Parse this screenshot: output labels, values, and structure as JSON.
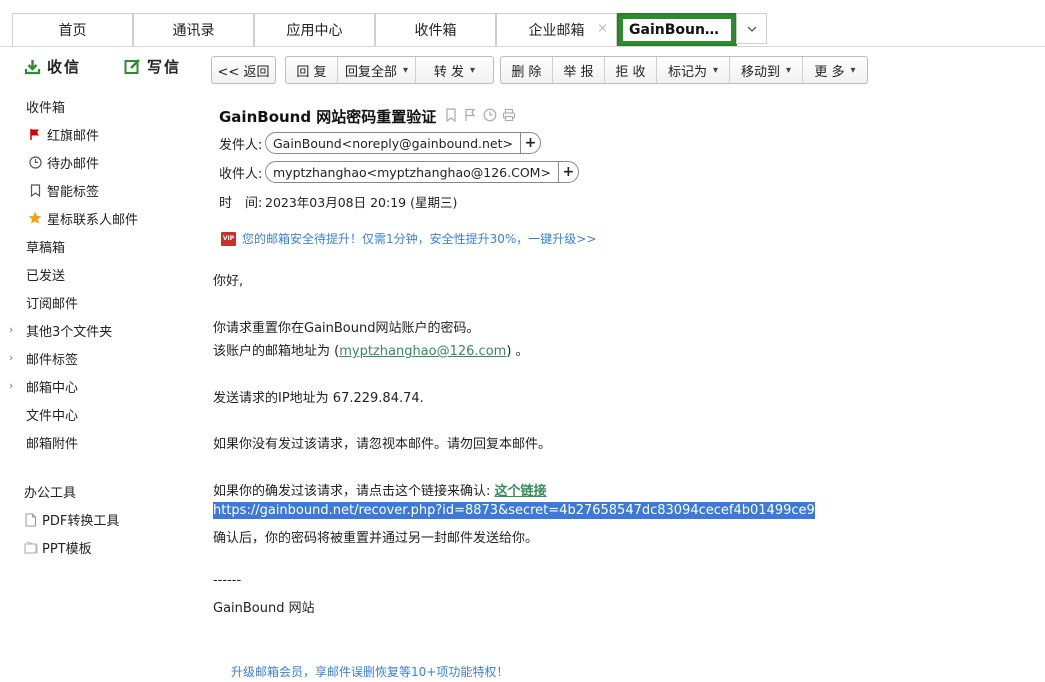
{
  "tabs": [
    {
      "label": "首页"
    },
    {
      "label": "通讯录"
    },
    {
      "label": "应用中心"
    },
    {
      "label": "收件箱"
    },
    {
      "label": "企业邮箱",
      "close": "×"
    },
    {
      "label": "GainBoun…",
      "active": true
    }
  ],
  "sidebar": {
    "receive": "收信",
    "compose": "写信",
    "items": [
      {
        "label": "收件箱"
      },
      {
        "label": "红旗邮件"
      },
      {
        "label": "待办邮件"
      },
      {
        "label": "智能标签"
      },
      {
        "label": "星标联系人邮件"
      },
      {
        "label": "草稿箱"
      },
      {
        "label": "已发送"
      },
      {
        "label": "订阅邮件"
      },
      {
        "label": "其他3个文件夹"
      },
      {
        "label": "邮件标签"
      },
      {
        "label": "邮箱中心"
      },
      {
        "label": "文件中心"
      },
      {
        "label": "邮箱附件"
      }
    ],
    "tools_title": "办公工具",
    "tools": [
      {
        "label": "PDF转换工具"
      },
      {
        "label": "PPT模板"
      }
    ]
  },
  "toolbar": {
    "back": "<< 返回",
    "reply": "回 复",
    "reply_all": "回复全部",
    "forward": "转 发",
    "delete": "删 除",
    "report": "举 报",
    "reject": "拒 收",
    "mark_as": "标记为",
    "move_to": "移动到",
    "more": "更 多"
  },
  "mail": {
    "subject": "GainBound 网站密码重置验证",
    "from_label": "发件人:",
    "from": "GainBound<noreply@gainbound.net>",
    "to_label": "收件人:",
    "to": "myptzhanghao<myptzhanghao@126.COM>",
    "time_label": "时　间:",
    "time": "2023年03月08日 20:19 (星期三)",
    "vip_badge": "VIP",
    "promo": "您的邮箱安全待提升！仅需1分钟，安全性提升30%，一键升级>>",
    "greeting": "你好,",
    "p1": "你请求重置你在GainBound网站账户的密码。",
    "p2_prefix": "该账户的邮箱地址为 (",
    "p2_email": "myptzhanghao@126.com",
    "p2_suffix": ") 。",
    "p3": "发送请求的IP地址为 67.229.84.74.",
    "p4": "如果你没有发过该请求，请忽视本邮件。请勿回复本邮件。",
    "p5_prefix": "如果你的确发过该请求，请点击这个链接来确认: ",
    "p5_link": "这个链接",
    "url": "https://gainbound.net/recover.php?id=8873&secret=4b27658547dc83094cecef4b01499ce9",
    "p6": "确认后，你的密码将被重置并通过另一封邮件发送给你。",
    "sig_sep": "------",
    "sig": "GainBound 网站"
  },
  "footer_promo": "升级邮箱会员，享邮件误删恢复等10+项功能特权！",
  "colors": {
    "accent_green": "#2e8b2e",
    "link_blue": "#3c7fd6",
    "link_green": "#3a8a5a",
    "selection": "#3d7ad8"
  }
}
